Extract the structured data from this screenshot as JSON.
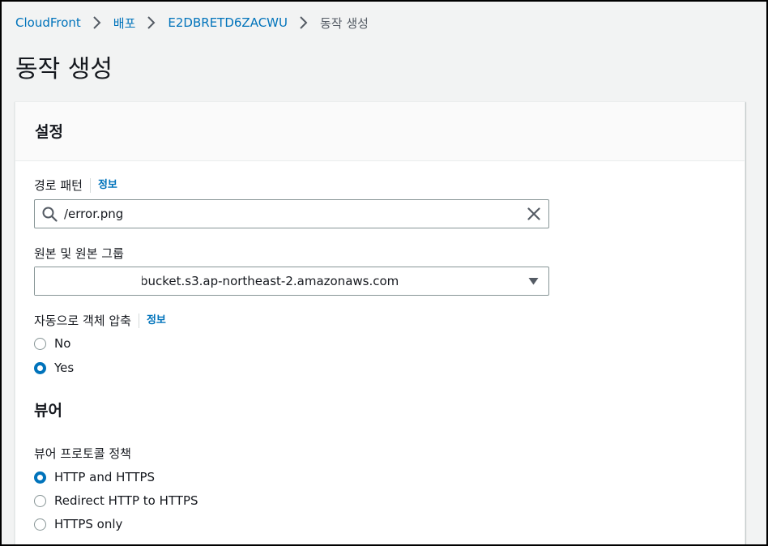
{
  "breadcrumb": {
    "items": [
      "CloudFront",
      "배포",
      "E2DBRETD6ZACWU"
    ],
    "current": "동작 생성"
  },
  "page_title": "동작 생성",
  "panel": {
    "title": "설정",
    "path_pattern": {
      "label": "경로 패턴",
      "info": "정보",
      "value": "/error.png"
    },
    "origin": {
      "label": "원본 및 원본 그룹",
      "value": "bucket.s3.ap-northeast-2.amazonaws.com"
    },
    "compress": {
      "label": "자동으로 객체 압축",
      "info": "정보",
      "options": [
        "No",
        "Yes"
      ],
      "selected": "Yes"
    },
    "viewer": {
      "section_title": "뷰어",
      "protocol_label": "뷰어 프로토콜 정책",
      "options": [
        "HTTP and HTTPS",
        "Redirect HTTP to HTTPS",
        "HTTPS only"
      ],
      "selected": "HTTP and HTTPS"
    }
  },
  "colors": {
    "link": "#0073bb",
    "text": "#16191f",
    "background": "#f2f3f3",
    "border": "#879596"
  }
}
